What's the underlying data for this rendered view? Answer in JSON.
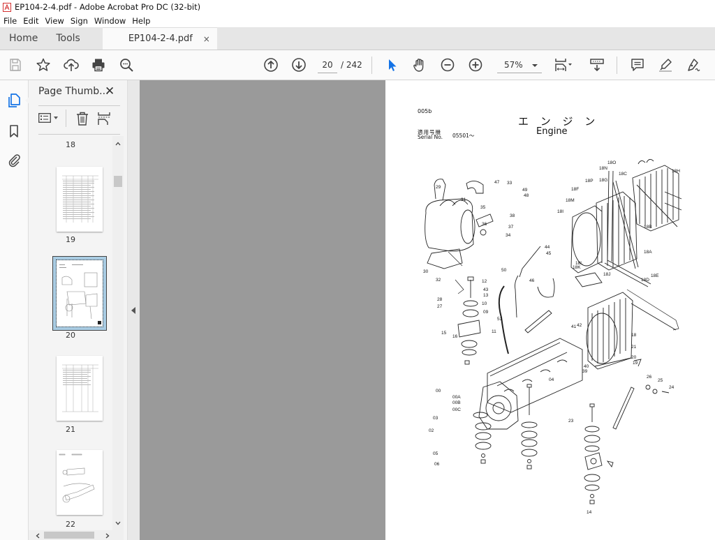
{
  "window": {
    "title": "EP104-2-4.pdf - Adobe Acrobat Pro DC (32-bit)",
    "app_icon": "acrobat-icon"
  },
  "menu": [
    "File",
    "Edit",
    "View",
    "Sign",
    "Window",
    "Help"
  ],
  "tabs": {
    "home": "Home",
    "tools": "Tools",
    "document": "EP104-2-4.pdf",
    "close_glyph": "×"
  },
  "toolbar": {
    "icons_left": [
      "save-icon",
      "bookmark-star-icon",
      "cloud-upload-icon",
      "print-icon",
      "search-zoom-icon"
    ],
    "prev_page": "arrow-up-circle-icon",
    "next_page": "arrow-down-circle-icon",
    "current_page": "20",
    "total_pages": "/ 242",
    "zoom_level": "57%",
    "icons_right": [
      "select-cursor-icon",
      "hand-icon",
      "zoom-out-icon",
      "zoom-in-icon",
      "fit-page-icon",
      "scroll-mode-icon",
      "comment-icon",
      "highlight-icon",
      "sign-icon"
    ]
  },
  "left_rail": [
    "page-thumbnails-icon",
    "bookmarks-icon",
    "attachments-icon"
  ],
  "thumbnail_panel": {
    "title": "Page Thumb...",
    "close_glyph": "✕",
    "pages": [
      {
        "number": "18",
        "selected": false
      },
      {
        "number": "19",
        "selected": false
      },
      {
        "number": "20",
        "selected": true
      },
      {
        "number": "21",
        "selected": false
      },
      {
        "number": "22",
        "selected": false
      }
    ]
  },
  "document_page": {
    "code": "005b",
    "title_jp": "エ ン ジ ン",
    "title_en": "Engine",
    "serial_label_jp": "適用号機",
    "serial_label_en": "Serial No.",
    "serial_value": "05501～",
    "callouts_upper_left": [
      "29",
      "31",
      "47",
      "33",
      "49",
      "48",
      "35",
      "36",
      "37",
      "38",
      "34",
      "30",
      "32",
      "27",
      "28",
      "12",
      "13",
      "10",
      "09",
      "11",
      "15",
      "16",
      "43",
      "50",
      "45",
      "44",
      "46",
      "51"
    ],
    "callouts_radiator": [
      "18O",
      "18N",
      "18H",
      "18P",
      "18G",
      "18C",
      "18F",
      "18M",
      "18I",
      "18B",
      "18A",
      "18L",
      "18K",
      "18J",
      "18D",
      "18E"
    ],
    "callouts_engine": [
      "00",
      "00A",
      "00B",
      "00C",
      "03",
      "02",
      "05",
      "06",
      "04",
      "23",
      "24",
      "25",
      "26",
      "39",
      "40",
      "41",
      "42",
      "18",
      "19",
      "20",
      "21",
      "14"
    ]
  }
}
